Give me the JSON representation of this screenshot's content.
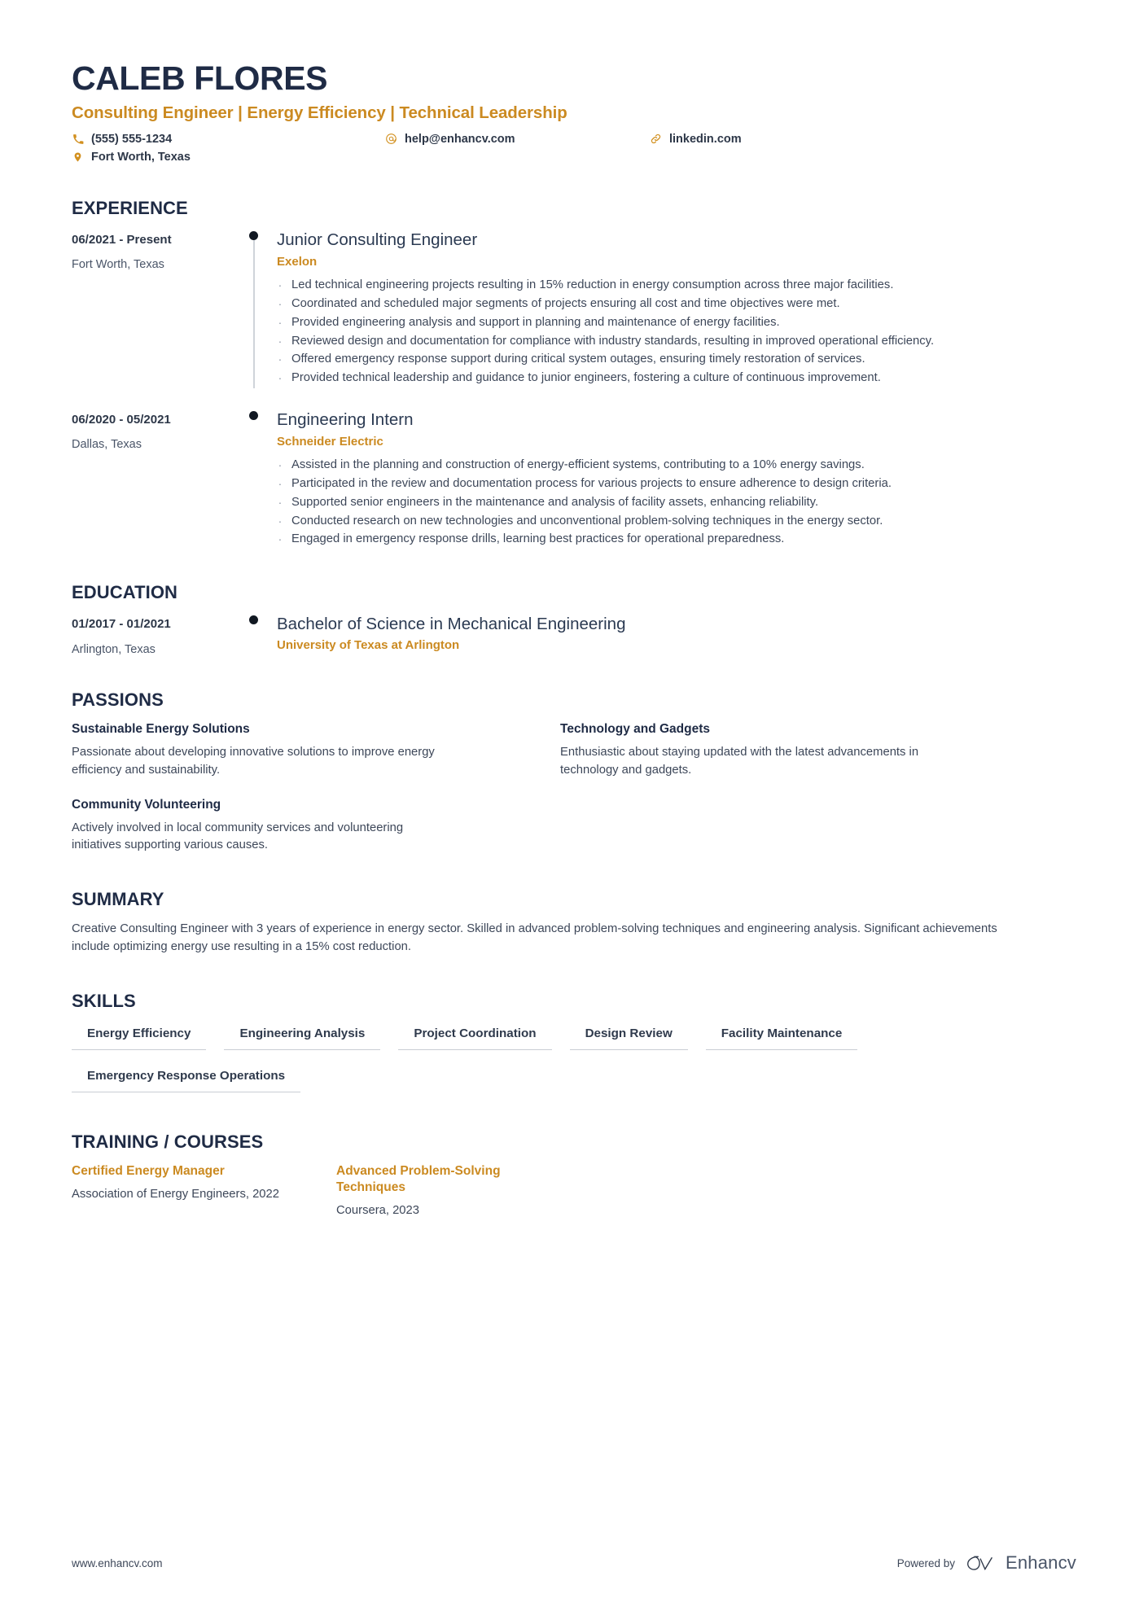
{
  "header": {
    "full_name": "CALEB FLORES",
    "headline": "Consulting Engineer | Energy Efficiency | Technical Leadership",
    "accent_color": "#cb8a21",
    "name_color": "#1f2b45",
    "contacts": [
      {
        "icon": "phone-icon",
        "text": "(555) 555-1234"
      },
      {
        "icon": "email-icon",
        "text": "help@enhancv.com"
      },
      {
        "icon": "link-icon",
        "text": "linkedin.com"
      },
      {
        "icon": "location-pin-icon",
        "text": "Fort Worth, Texas"
      }
    ]
  },
  "experience": {
    "title": "EXPERIENCE",
    "entries": [
      {
        "period": "06/2021 - Present",
        "location": "Fort Worth, Texas",
        "role": "Junior Consulting Engineer",
        "company": "Exelon",
        "bullets": [
          "Led technical engineering projects resulting in 15% reduction in energy consumption across three major facilities.",
          "Coordinated and scheduled major segments of projects ensuring all cost and time objectives were met.",
          "Provided engineering analysis and support in planning and maintenance of energy facilities.",
          "Reviewed design and documentation for compliance with industry standards, resulting in improved operational efficiency.",
          "Offered emergency response support during critical system outages, ensuring timely restoration of services.",
          "Provided technical leadership and guidance to junior engineers, fostering a culture of continuous improvement."
        ]
      },
      {
        "period": "06/2020 - 05/2021",
        "location": "Dallas, Texas",
        "role": "Engineering Intern",
        "company": "Schneider Electric",
        "bullets": [
          "Assisted in the planning and construction of energy-efficient systems, contributing to a 10% energy savings.",
          "Participated in the review and documentation process for various projects to ensure adherence to design criteria.",
          "Supported senior engineers in the maintenance and analysis of facility assets, enhancing reliability.",
          "Conducted research on new technologies and unconventional problem-solving techniques in the energy sector.",
          "Engaged in emergency response drills, learning best practices for operational preparedness."
        ]
      }
    ]
  },
  "education": {
    "title": "EDUCATION",
    "entries": [
      {
        "period": "01/2017 - 01/2021",
        "location": "Arlington, Texas",
        "degree": "Bachelor of Science in Mechanical Engineering",
        "school": "University of Texas at Arlington"
      }
    ]
  },
  "passions": {
    "title": "PASSIONS",
    "items": [
      {
        "name": "Sustainable Energy Solutions",
        "description": "Passionate about developing innovative solutions to improve energy efficiency and sustainability."
      },
      {
        "name": "Technology and Gadgets",
        "description": "Enthusiastic about staying updated with the latest advancements in technology and gadgets."
      },
      {
        "name": "Community Volunteering",
        "description": "Actively involved in local community services and volunteering initiatives supporting various causes."
      }
    ]
  },
  "summary": {
    "title": "SUMMARY",
    "text": "Creative Consulting Engineer with 3 years of experience in energy sector. Skilled in advanced problem-solving techniques and engineering analysis. Significant achievements include optimizing energy use resulting in a 15% cost reduction."
  },
  "skills": {
    "title": "SKILLS",
    "items": [
      "Energy Efficiency",
      "Engineering Analysis",
      "Project Coordination",
      "Design Review",
      "Facility Maintenance",
      "Emergency Response Operations"
    ]
  },
  "training": {
    "title": "TRAINING / COURSES",
    "items": [
      {
        "name": "Certified Energy Manager",
        "meta": "Association of Energy Engineers, 2022"
      },
      {
        "name": "Advanced Problem-Solving Techniques",
        "meta": "Coursera, 2023"
      }
    ]
  },
  "footer": {
    "url": "www.enhancv.com",
    "powered_by": "Powered by",
    "brand": "Enhancv"
  }
}
